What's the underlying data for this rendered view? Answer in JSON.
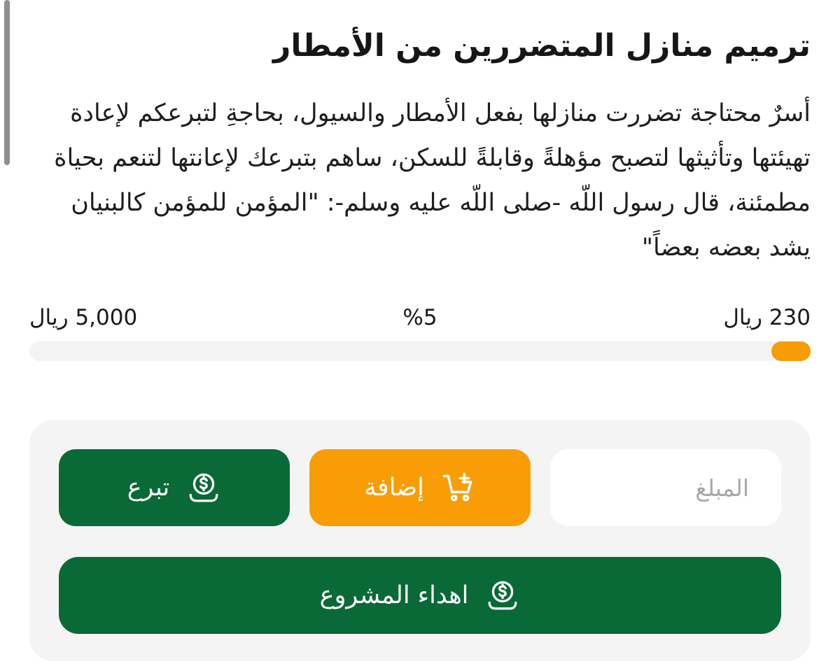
{
  "project": {
    "title": "ترميم منازل المتضررين من الأمطار",
    "description": "أسرٌ محتاجة تضررت منازلها بفعل الأمطار والسيول، بحاجةِ لتبرعكم لإعادة تهيئتها وتأثيثها لتصبح مؤهلةً وقابلةً للسكن، ساهم بتبرعك لإعانتها لتنعم بحياة مطمئنة، قال رسول اللّه -صلى اللّه عليه وسلم-: \"المؤمن للمؤمن كالبنيان يشد بعضه بعضاً\""
  },
  "progress": {
    "raised": "230 ريال",
    "percent_label": "%5",
    "goal": "5,000 ريال",
    "fraction": 0.05
  },
  "form": {
    "amount_placeholder": "المبلغ",
    "amount_value": ""
  },
  "buttons": {
    "add_label": "إضافة",
    "add_icon": "cart-add-icon",
    "donate_label": "تبرع",
    "donate_icon": "money-hand-icon",
    "gift_label": "اهداء المشروع",
    "gift_icon": "money-hand-icon"
  },
  "colors": {
    "primary_green": "#096a37",
    "accent_orange": "#f89d06",
    "progress_track": "#f3f3f3",
    "panel_bg": "#f4f4f4"
  }
}
